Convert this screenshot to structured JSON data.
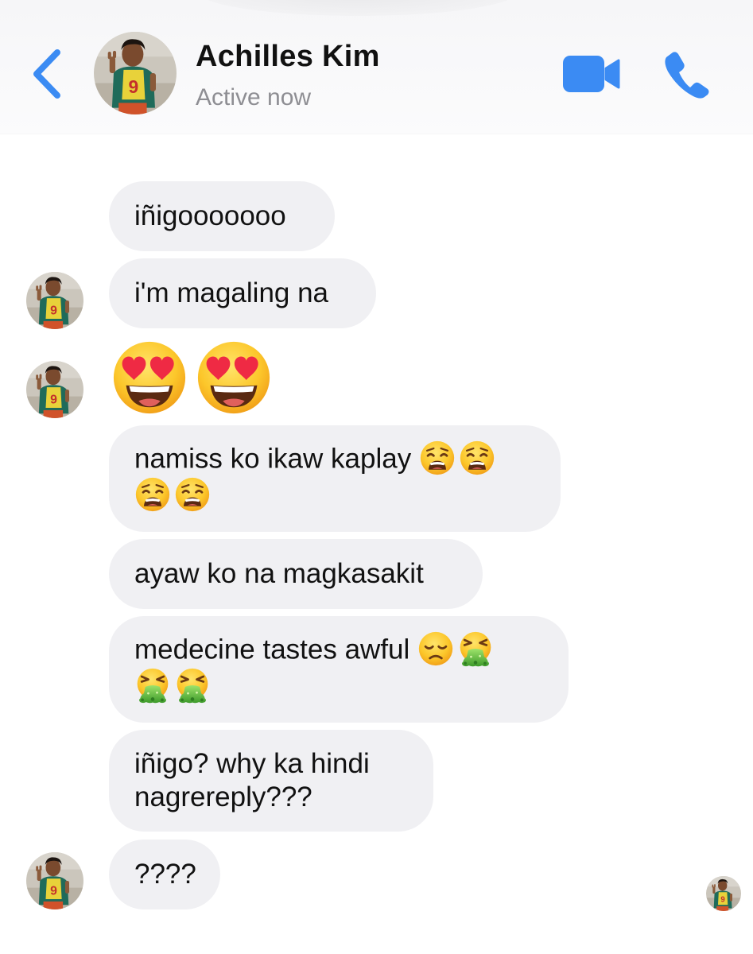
{
  "header": {
    "contact_name": "Achilles Kim",
    "status": "Active now",
    "back_icon": "chevron-left-icon",
    "video_icon": "video-camera-icon",
    "call_icon": "phone-icon",
    "accent_color": "#3b8bf3"
  },
  "messages": [
    {
      "text": "iñigooooooo"
    },
    {
      "text": "i'm magaling na"
    },
    {
      "emoji": [
        "smiling-face-with-heart-eyes",
        "smiling-face-with-heart-eyes"
      ]
    },
    {
      "line1": "namiss ko ikaw kaplay",
      "line1_emoji": [
        "weary-face",
        "weary-face"
      ],
      "line2_emoji": [
        "weary-face",
        "weary-face"
      ]
    },
    {
      "text": "ayaw ko na magkasakit"
    },
    {
      "line1": "medecine tastes awful",
      "line1_emoji": [
        "disappointed-face",
        "face-vomiting"
      ],
      "line2_emoji": [
        "face-vomiting",
        "face-vomiting"
      ]
    },
    {
      "line1": "iñigo? why ka hindi",
      "line2": "nagrereply???"
    },
    {
      "text": "????"
    }
  ],
  "bubble_color": "#f0f0f3"
}
